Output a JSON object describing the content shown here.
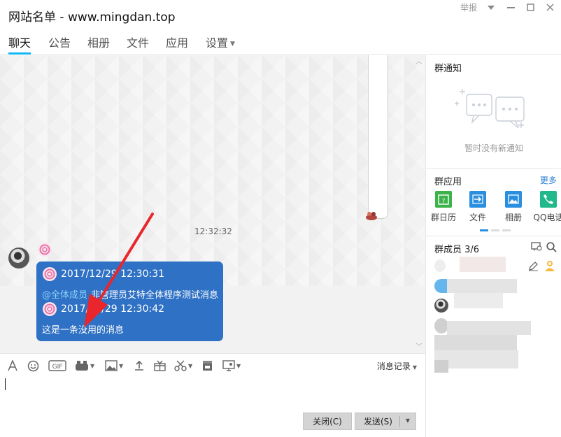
{
  "window": {
    "title": "网站名单 - www.mingdan.top",
    "report_label": "举报",
    "controls": [
      "dropdown-icon",
      "minimize-icon",
      "maximize-icon",
      "close-icon"
    ]
  },
  "tabs": [
    {
      "label": "聊天",
      "active": true
    },
    {
      "label": "公告"
    },
    {
      "label": "相册"
    },
    {
      "label": "文件"
    },
    {
      "label": "应用"
    },
    {
      "label": "设置",
      "has_dropdown": true
    }
  ],
  "chat": {
    "timestamp": "12:32:32",
    "message": {
      "line1_time": "2017/12/29 12:30:31",
      "mention": "@全体成员",
      "line2_text": "非管理员艾特全体程序测试消息",
      "line3_time": "2017/12/29 12:30:42",
      "line4_text": "这是一条没用的消息"
    },
    "bubble_color": "#2f71c4",
    "annotation_color": "#e8262b"
  },
  "toolbar": {
    "tools": [
      "font-icon",
      "emoji-icon",
      "gif-icon",
      "game-icon",
      "image-icon",
      "upload-icon",
      "gift-icon",
      "scissors-icon",
      "red-packet-icon",
      "screen-icon"
    ],
    "history_label": "消息记录"
  },
  "input": {
    "close_label": "关闭(C)",
    "send_label": "发送(S)"
  },
  "sidebar": {
    "notice_title": "群通知",
    "notice_empty": "暂时没有新通知",
    "apps_title": "群应用",
    "more_label": "更多",
    "apps": [
      {
        "label": "群日历",
        "color": "#3cb34a",
        "icon": "calendar-icon"
      },
      {
        "label": "文件",
        "color": "#2b8fe0",
        "icon": "file-icon"
      },
      {
        "label": "相册",
        "color": "#2b8fe0",
        "icon": "album-icon"
      },
      {
        "label": "QQ电话",
        "color": "#21b88b",
        "icon": "phone-icon"
      }
    ],
    "members_title": "群成员 3/6"
  },
  "accent_color": "#12b7f5"
}
